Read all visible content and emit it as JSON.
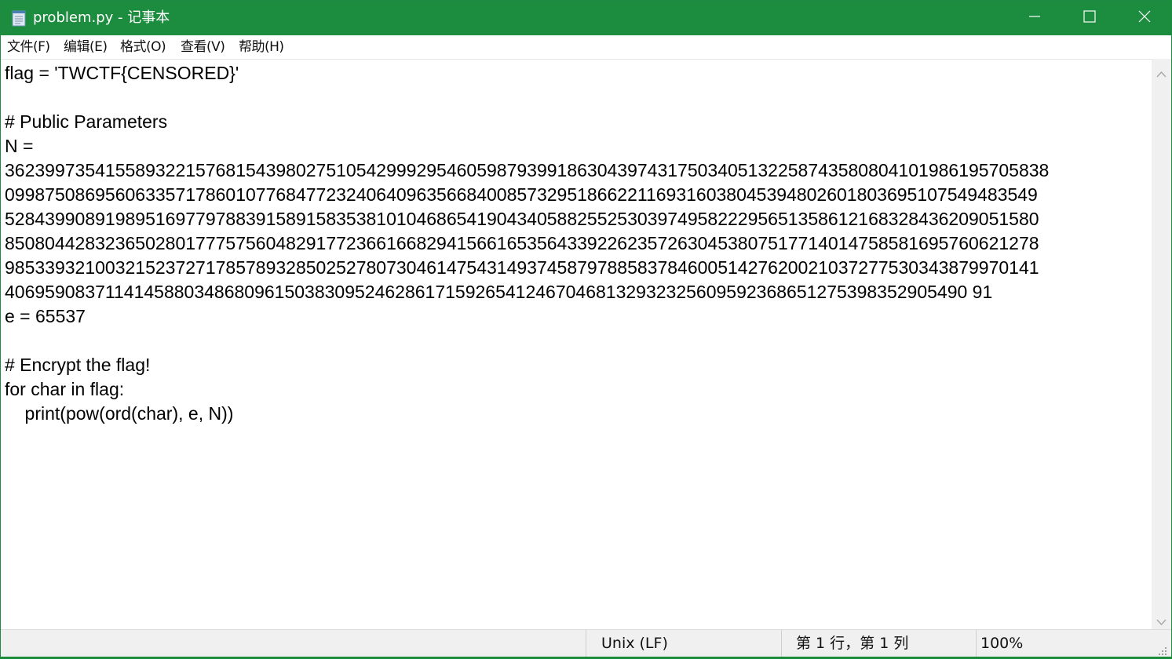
{
  "window": {
    "title": "problem.py - 记事本",
    "accent_color": "#1c8c3f",
    "icons": {
      "app": "notepad-icon",
      "minimize": "minimize-icon",
      "maximize": "maximize-icon",
      "close": "close-icon"
    }
  },
  "menu": {
    "items": [
      {
        "label": "文件(F)"
      },
      {
        "label": "编辑(E)"
      },
      {
        "label": "格式(O)"
      },
      {
        "label": "查看(V)"
      },
      {
        "label": "帮助(H)"
      }
    ]
  },
  "editor": {
    "lines": [
      "flag = 'TWCTF{CENSORED}'",
      "",
      "# Public Parameters",
      "N =",
      "36239973541558932215768154398027510542999295460598793991863043974317503405132258743580804101986195705838",
      "0998750869560633571786010776847723240640963566840085732951866221169316038045394802601803695107549483549",
      "5284399089198951697797883915891583538101046865419043405882552530397495822295651358612168328436209051580",
      "8508044283236502801777575604829177236616682941566165356433922623572630453807517714014758581695760621278",
      "9853393210032152372717857893285025278073046147543149374587978858378460051427620021037277530343879970141",
      "406959083711414588034868096150383095246286171592654124670468132932325609592368651275398352905490 91",
      "e = 65537",
      "",
      "# Encrypt the flag!",
      "for char in flag:",
      "    print(pow(ord(char), e, N))"
    ]
  },
  "status": {
    "line_ending": "Unix (LF)",
    "position": "第 1 行，第 1 列",
    "zoom": "100%"
  }
}
